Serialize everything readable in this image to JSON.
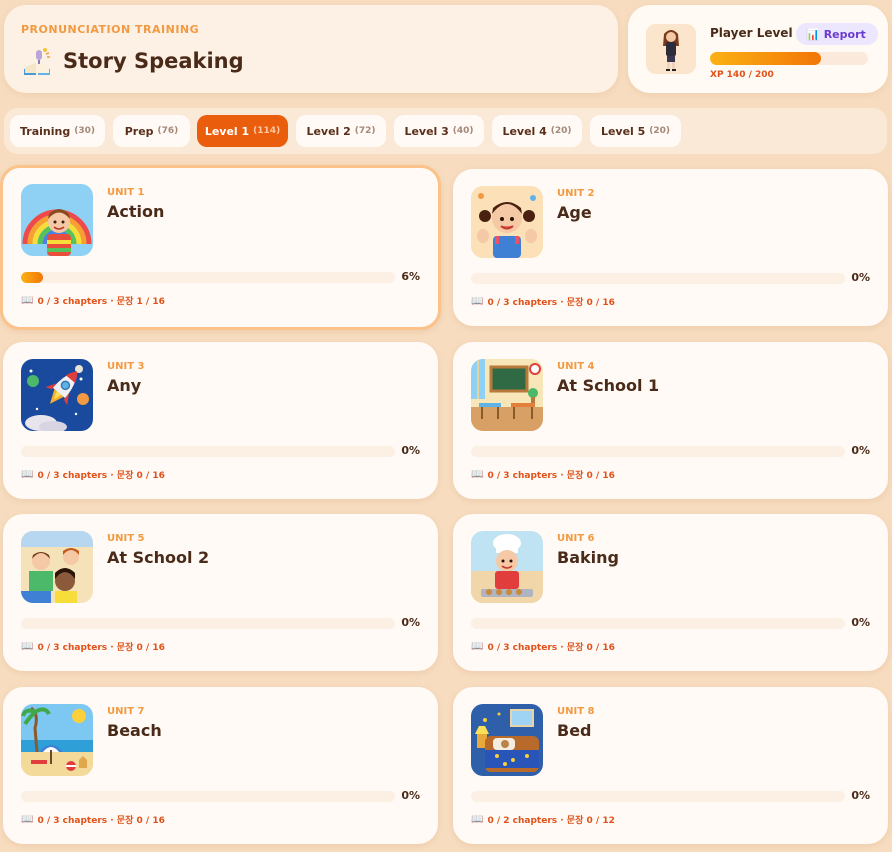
{
  "header": {
    "eyebrow": "PRONUNCIATION TRAINING",
    "title": "Story Speaking",
    "icon": "book-mic-icon"
  },
  "player": {
    "level_label": "Player Level 5",
    "report_label": "Report",
    "report_icon": "📊",
    "xp_text": "XP 140 / 200",
    "xp_progress": 0.7
  },
  "tabs": [
    {
      "label": "Training",
      "count": "(30)",
      "active": false
    },
    {
      "label": "Prep",
      "count": "(76)",
      "active": false
    },
    {
      "label": "Level 1",
      "count": "(114)",
      "active": true
    },
    {
      "label": "Level 2",
      "count": "(72)",
      "active": false
    },
    {
      "label": "Level 3",
      "count": "(40)",
      "active": false
    },
    {
      "label": "Level 4",
      "count": "(20)",
      "active": false
    },
    {
      "label": "Level 5",
      "count": "(20)",
      "active": false
    }
  ],
  "units": [
    {
      "unit": "UNIT 1",
      "name": "Action",
      "pct": "6%",
      "progress": 0.06,
      "meta": "0 / 3 chapters · 문장 1 / 16",
      "icon": "rainbow-kid-icon",
      "selected": true
    },
    {
      "unit": "UNIT 2",
      "name": "Age",
      "pct": "0%",
      "progress": 0,
      "meta": "0 / 3 chapters · 문장 0 / 16",
      "icon": "waving-girl-icon",
      "selected": false
    },
    {
      "unit": "UNIT 3",
      "name": "Any",
      "pct": "0%",
      "progress": 0,
      "meta": "0 / 3 chapters · 문장 0 / 16",
      "icon": "rocket-icon",
      "selected": false
    },
    {
      "unit": "UNIT 4",
      "name": "At School 1",
      "pct": "0%",
      "progress": 0,
      "meta": "0 / 3 chapters · 문장 0 / 16",
      "icon": "classroom-icon",
      "selected": false
    },
    {
      "unit": "UNIT 5",
      "name": "At School 2",
      "pct": "0%",
      "progress": 0,
      "meta": "0 / 3 chapters · 문장 0 / 16",
      "icon": "students-icon",
      "selected": false
    },
    {
      "unit": "UNIT 6",
      "name": "Baking",
      "pct": "0%",
      "progress": 0,
      "meta": "0 / 3 chapters · 문장 0 / 16",
      "icon": "chef-kid-icon",
      "selected": false
    },
    {
      "unit": "UNIT 7",
      "name": "Beach",
      "pct": "0%",
      "progress": 0,
      "meta": "0 / 3 chapters · 문장 0 / 16",
      "icon": "beach-icon",
      "selected": false
    },
    {
      "unit": "UNIT 8",
      "name": "Bed",
      "pct": "0%",
      "progress": 0,
      "meta": "0 / 2 chapters · 문장 0 / 12",
      "icon": "bed-icon",
      "selected": false
    }
  ],
  "colors": {
    "accent": "#ea5d0d",
    "progress_start": "#fbb114",
    "progress_end": "#f27607",
    "unit_label": "#f29a42",
    "background": "#f7dcbf"
  }
}
